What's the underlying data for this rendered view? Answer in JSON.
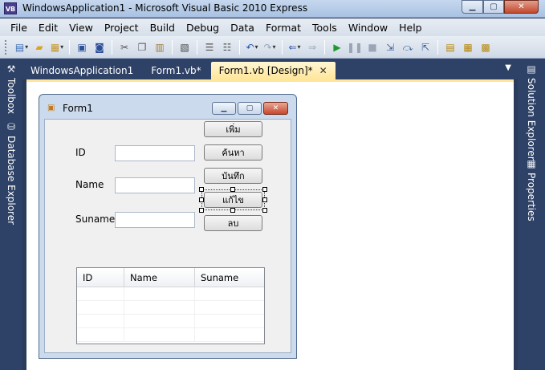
{
  "window": {
    "app_icon_text": "VB",
    "title": "WindowsApplication1 - Microsoft Visual Basic 2010 Express",
    "min_glyph": "▁",
    "max_glyph": "▢",
    "close_glyph": "✕"
  },
  "menu": [
    "File",
    "Edit",
    "View",
    "Project",
    "Build",
    "Debug",
    "Data",
    "Format",
    "Tools",
    "Window",
    "Help"
  ],
  "toolbar_icons": [
    "new-project-icon",
    "open-file-icon",
    "add-item-icon",
    "save-icon",
    "save-all-icon",
    "cut-icon",
    "copy-icon",
    "paste-icon",
    "find-icon",
    "comment-icon",
    "uncomment-icon",
    "undo-icon",
    "redo-icon",
    "navigate-back-icon",
    "navigate-forward-icon",
    "start-debug-icon",
    "pause-icon",
    "stop-icon",
    "step-into-icon",
    "step-over-icon",
    "step-out-icon",
    "solution-explorer-icon",
    "properties-icon",
    "toolbox-icon"
  ],
  "left_panels": {
    "toolbox": "Toolbox",
    "database_explorer": "Database Explorer"
  },
  "right_panels": {
    "solution_explorer": "Solution Explorer",
    "properties": "Properties"
  },
  "doc_tabs": [
    {
      "label": "WindowsApplication1",
      "active": false
    },
    {
      "label": "Form1.vb*",
      "active": false
    },
    {
      "label": "Form1.vb [Design]*",
      "active": true
    }
  ],
  "tab_close_glyph": "✕",
  "tab_dropdown_glyph": "▼",
  "form": {
    "title": "Form1",
    "labels": {
      "id": "ID",
      "name": "Name",
      "suname": "Suname"
    },
    "buttons": {
      "add": "เพิ่ม",
      "search": "ค้นหา",
      "save": "บันทึก",
      "edit": "แก้ไข",
      "delete": "ลบ"
    },
    "grid": {
      "columns": [
        "ID",
        "Name",
        "Suname"
      ],
      "empty_rows": 4
    }
  },
  "colors": {
    "ide_background": "#2b3c5a",
    "active_tab": "#ffe69a",
    "form_frame": "#cbdbed"
  }
}
